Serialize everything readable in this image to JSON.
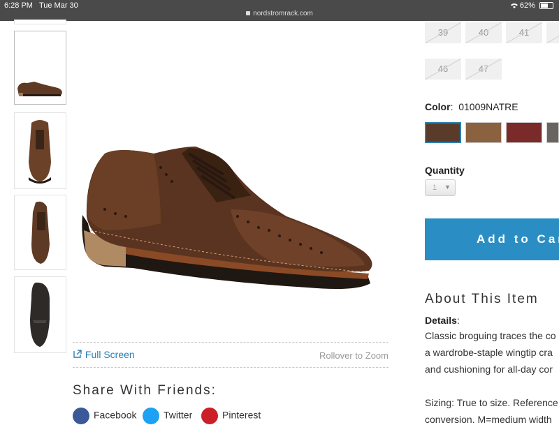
{
  "status_bar": {
    "time": "6:28 PM",
    "date": "Tue Mar 30",
    "url": "nordstromrack.com",
    "battery": "62%",
    "battery_level": 0.62
  },
  "gallery": {
    "thumbnails": [
      {
        "name": "side-view"
      },
      {
        "name": "top-front-view"
      },
      {
        "name": "top-view"
      },
      {
        "name": "sole-view"
      }
    ],
    "full_screen_label": "Full Screen",
    "rollover_label": "Rollover to Zoom"
  },
  "share": {
    "title": "Share With Friends:",
    "items": [
      {
        "label": "Facebook",
        "color": "#3b5998"
      },
      {
        "label": "Twitter",
        "color": "#1da1f2"
      },
      {
        "label": "Pinterest",
        "color": "#cb2027"
      }
    ]
  },
  "sizes": {
    "row1": [
      "39",
      "40",
      "41"
    ],
    "row2": [
      "46",
      "47"
    ]
  },
  "color": {
    "label": "Color",
    "value": "01009NATRE",
    "swatches": [
      {
        "color": "#5a3a28",
        "selected": true
      },
      {
        "color": "#8a6240",
        "selected": false
      },
      {
        "color": "#7b2a2a",
        "selected": false
      },
      {
        "color": "#6a6460",
        "selected": false
      }
    ]
  },
  "quantity": {
    "label": "Quantity",
    "value": "1"
  },
  "cart": {
    "button_label": "Add to Car"
  },
  "about": {
    "title": "About This Item",
    "details_label": "Details",
    "lines": [
      "Classic broguing traces the co",
      "a wardrobe-staple wingtip cra",
      "and cushioning for all-day cor",
      "",
      "Sizing: True to size. Reference",
      "conversion. M=medium width"
    ]
  },
  "accent_color": "#2a8ec4"
}
